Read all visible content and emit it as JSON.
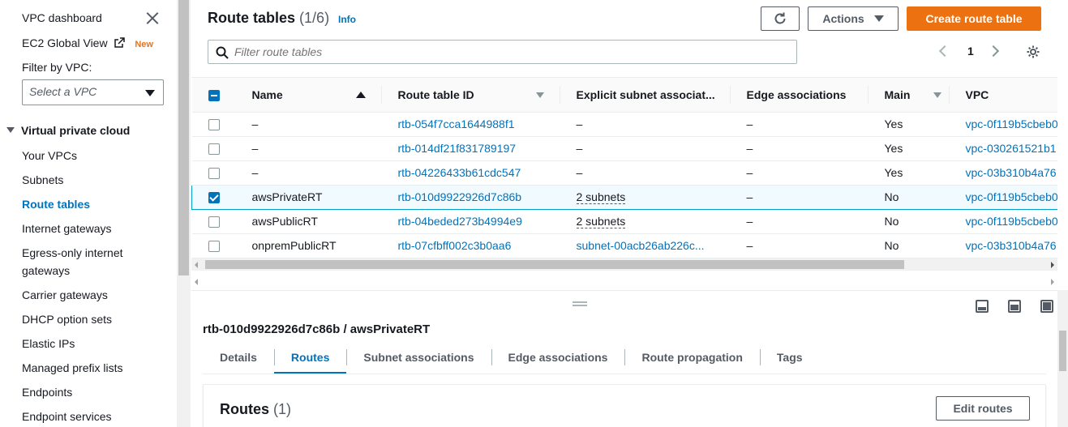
{
  "sidebar": {
    "dashboard": "VPC dashboard",
    "ec2_global_view": "EC2 Global View",
    "new_badge": "New",
    "filter_label": "Filter by VPC:",
    "vpc_select_placeholder": "Select a VPC",
    "section_title": "Virtual private cloud",
    "items": [
      {
        "label": "Your VPCs"
      },
      {
        "label": "Subnets"
      },
      {
        "label": "Route tables"
      },
      {
        "label": "Internet gateways"
      },
      {
        "label": "Egress-only internet"
      },
      {
        "label": "gateways"
      },
      {
        "label": "Carrier gateways"
      },
      {
        "label": "DHCP option sets"
      },
      {
        "label": "Elastic IPs"
      },
      {
        "label": "Managed prefix lists"
      },
      {
        "label": "Endpoints"
      },
      {
        "label": "Endpoint services"
      }
    ]
  },
  "header": {
    "title": "Route tables",
    "count": "(1/6)",
    "info": "Info",
    "actions_label": "Actions",
    "create_label": "Create route table",
    "search_placeholder": "Filter route tables",
    "page": "1"
  },
  "table": {
    "columns": [
      "Name",
      "Route table ID",
      "Explicit subnet associat...",
      "Edge associations",
      "Main",
      "VPC"
    ],
    "rows": [
      {
        "name": "–",
        "id": "rtb-054f7cca1644988f1",
        "subnet": "–",
        "edge": "–",
        "main": "Yes",
        "vpc": "vpc-0f119b5cbeb0",
        "checked": false
      },
      {
        "name": "–",
        "id": "rtb-014df21f831789197",
        "subnet": "–",
        "edge": "–",
        "main": "Yes",
        "vpc": "vpc-030261521b1",
        "checked": false
      },
      {
        "name": "–",
        "id": "rtb-04226433b61cdc547",
        "subnet": "–",
        "edge": "–",
        "main": "Yes",
        "vpc": "vpc-03b310b4a76",
        "checked": false
      },
      {
        "name": "awsPrivateRT",
        "id": "rtb-010d9922926d7c86b",
        "subnet": "2 subnets",
        "edge": "–",
        "main": "No",
        "vpc": "vpc-0f119b5cbeb0",
        "checked": true
      },
      {
        "name": "awsPublicRT",
        "id": "rtb-04beded273b4994e9",
        "subnet": "2 subnets",
        "edge": "–",
        "main": "No",
        "vpc": "vpc-0f119b5cbeb0",
        "checked": false
      },
      {
        "name": "onpremPublicRT",
        "id": "rtb-07cfbff002c3b0aa6",
        "subnet": "subnet-00acb26ab226c...",
        "edge": "–",
        "main": "No",
        "vpc": "vpc-03b310b4a76",
        "checked": false
      }
    ]
  },
  "detail": {
    "title": "rtb-010d9922926d7c86b / awsPrivateRT",
    "tabs": [
      {
        "label": "Details"
      },
      {
        "label": "Routes"
      },
      {
        "label": "Subnet associations"
      },
      {
        "label": "Edge associations"
      },
      {
        "label": "Route propagation"
      },
      {
        "label": "Tags"
      }
    ],
    "active_tab": "Routes",
    "routes_title": "Routes",
    "routes_count": "(1)",
    "edit_routes": "Edit routes"
  },
  "colors": {
    "accent": "#ec7211",
    "link": "#0073bb",
    "text": "#16191f"
  },
  "icons": [
    "close-icon",
    "external-link-icon",
    "refresh-icon",
    "search-icon",
    "settings-gear-icon",
    "chevron-left-icon",
    "chevron-right-icon",
    "sort-ascending-icon",
    "sort-descending-icon",
    "pane-bottom-icon",
    "pane-side-icon",
    "pane-full-icon"
  ]
}
